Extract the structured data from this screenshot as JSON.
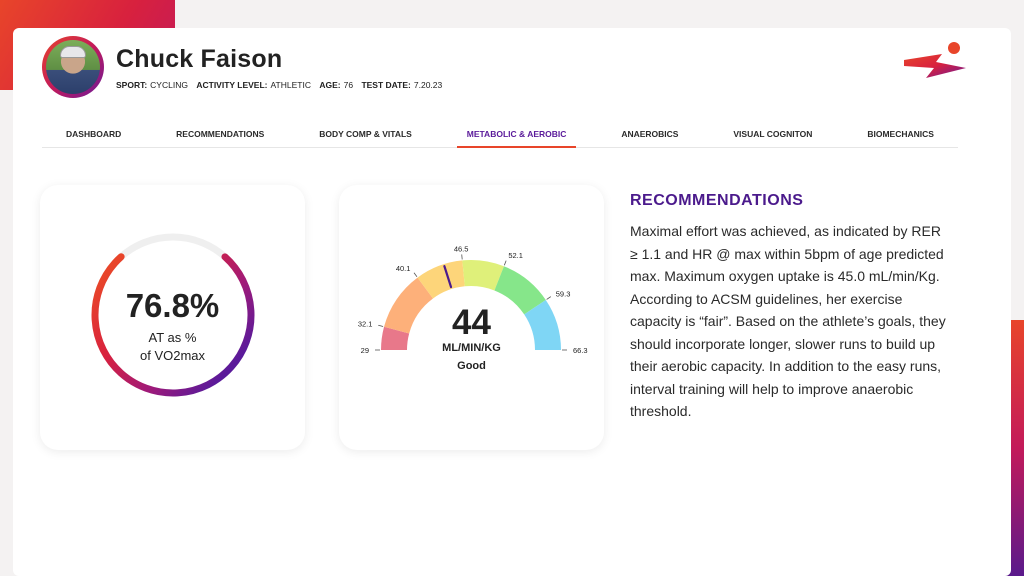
{
  "athlete": {
    "name": "Chuck Faison",
    "meta": [
      {
        "key": "SPORT:",
        "value": "CYCLING"
      },
      {
        "key": "ACTIVITY LEVEL:",
        "value": "ATHLETIC"
      },
      {
        "key": "AGE:",
        "value": "76"
      },
      {
        "key": "TEST DATE:",
        "value": "7.20.23"
      }
    ]
  },
  "tabs": [
    {
      "label": "Dashboard",
      "active": false
    },
    {
      "label": "Recommendations",
      "active": false
    },
    {
      "label": "Body Comp & Vitals",
      "active": false
    },
    {
      "label": "Metabolic & Aerobic",
      "active": true
    },
    {
      "label": "Anaerobics",
      "active": false
    },
    {
      "label": "Visual Cogniton",
      "active": false
    },
    {
      "label": "Biomechanics",
      "active": false
    }
  ],
  "at_card": {
    "value": "76.8%",
    "label_line1": "AT as %",
    "label_line2": "of VO2max",
    "progress_fraction": 0.768
  },
  "vo2_card": {
    "value": "44",
    "unit": "ML/MIN/KG",
    "rating": "Good",
    "thresholds": [
      "29",
      "32.1",
      "40.1",
      "46.5",
      "52.1",
      "59.3",
      "66.3"
    ],
    "segment_colors": [
      "#e8788a",
      "#fdb07a",
      "#fdd57a",
      "#dff07a",
      "#86e68a",
      "#7fd6f5"
    ],
    "marker_value": 44
  },
  "recommendations": {
    "title": "RECOMMENDATIONS",
    "body": "Maximal effort was achieved, as indicated by RER ≥ 1.1 and HR @ max within 5bpm of age predicted max. Maximum oxygen uptake is 45.0 mL/min/Kg. According to ACSM guidelines, her exercise capacity is “fair”. Based on the athlete’s goals, they should incorporate longer, slower runs to build up their aerobic capacity. In addition to the easy runs, interval training will help to improve anaerobic threshold."
  },
  "colors": {
    "accent": "#4b1a8c",
    "brand_orange": "#e8452a",
    "brand_magenta": "#c31a5a"
  }
}
